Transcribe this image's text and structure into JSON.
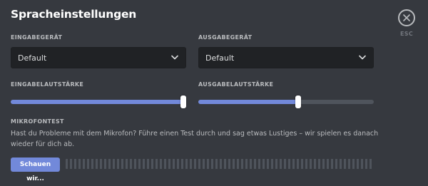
{
  "header": {
    "title": "Spracheinstellungen",
    "close_label": "ESC"
  },
  "input_device": {
    "label": "EINGABEGERÄT",
    "value": "Default"
  },
  "output_device": {
    "label": "AUSGABEGERÄT",
    "value": "Default"
  },
  "input_volume": {
    "label": "EINGABELAUTSTÄRKE",
    "level_percent": 100
  },
  "output_volume": {
    "label": "AUSGABELAUTSTÄRKE",
    "level_percent": 57
  },
  "mic_test": {
    "label": "MIKROFONTEST",
    "description": "Hast du Probleme mit dem Mikrofon? Führe einen Test durch und sag etwas Lustiges – wir spielen es danach wieder für dich ab.",
    "button_label": "Schauen wir...",
    "level_percent": 0
  },
  "colors": {
    "background": "#36393f",
    "accent": "#7289da",
    "input_bg": "#202225",
    "track": "#4f545c"
  },
  "icons": {
    "close": "close-icon",
    "chevron": "chevron-down-icon"
  }
}
